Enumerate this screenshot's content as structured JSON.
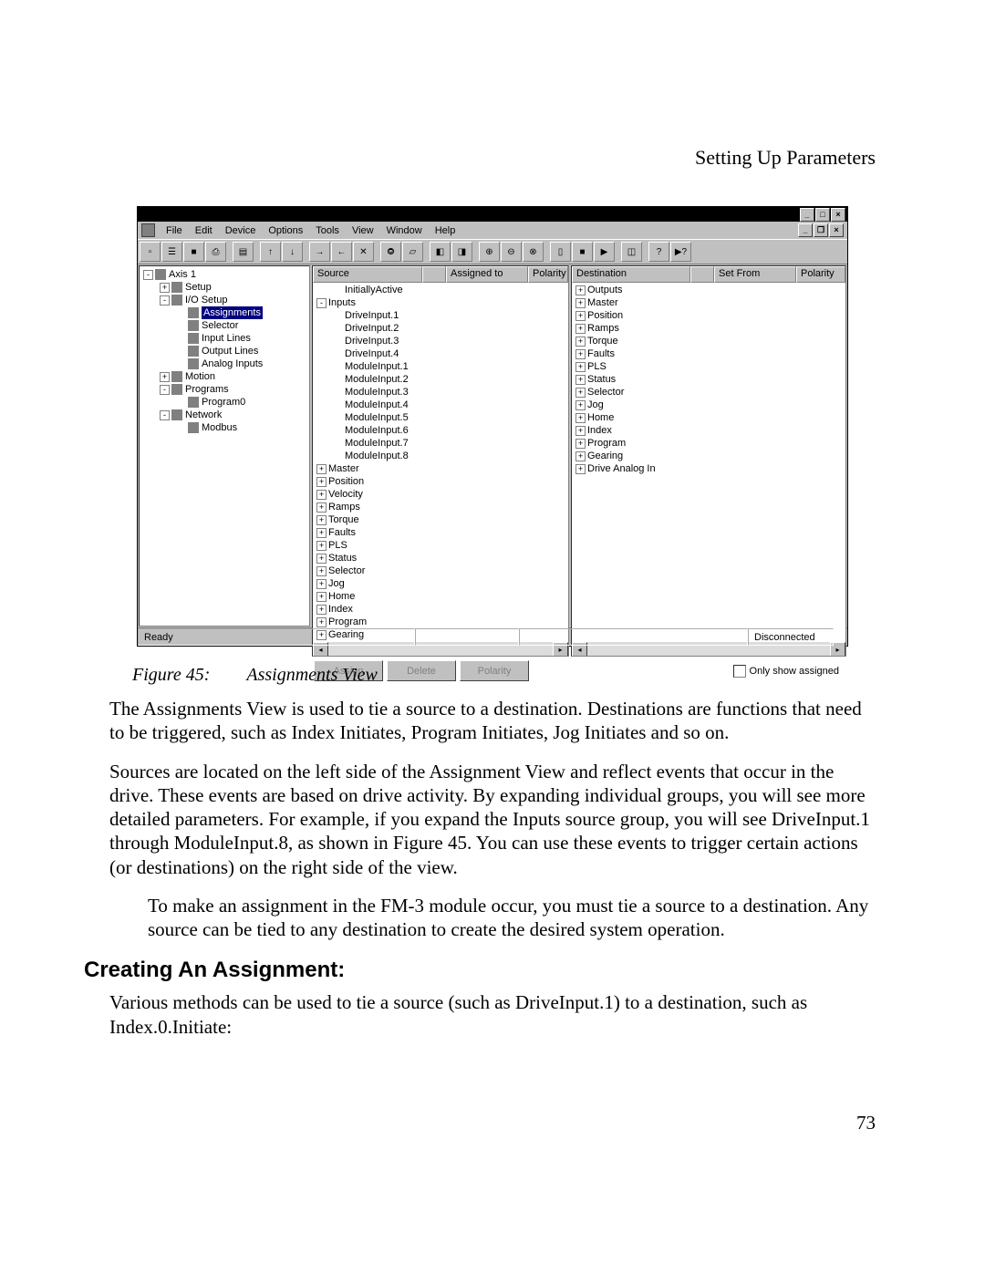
{
  "header": {
    "section_title": "Setting Up Parameters"
  },
  "window": {
    "title_buttons": {
      "min": "_",
      "max": "□",
      "close": "×"
    },
    "mdi_buttons": {
      "min": "_",
      "restore": "❐",
      "close": "×"
    },
    "menu": [
      "File",
      "Edit",
      "Device",
      "Options",
      "Tools",
      "View",
      "Window",
      "Help"
    ]
  },
  "tree": {
    "root": "Axis 1",
    "items": [
      {
        "indent": 0,
        "exp": "-",
        "label": "Axis 1"
      },
      {
        "indent": 1,
        "exp": "+",
        "label": "Setup"
      },
      {
        "indent": 1,
        "exp": "-",
        "label": "I/O Setup"
      },
      {
        "indent": 2,
        "exp": "",
        "label": "Assignments",
        "sel": true
      },
      {
        "indent": 2,
        "exp": "",
        "label": "Selector"
      },
      {
        "indent": 2,
        "exp": "",
        "label": "Input Lines"
      },
      {
        "indent": 2,
        "exp": "",
        "label": "Output Lines"
      },
      {
        "indent": 2,
        "exp": "",
        "label": "Analog Inputs"
      },
      {
        "indent": 1,
        "exp": "+",
        "label": "Motion"
      },
      {
        "indent": 1,
        "exp": "-",
        "label": "Programs"
      },
      {
        "indent": 2,
        "exp": "",
        "label": "Program0"
      },
      {
        "indent": 1,
        "exp": "-",
        "label": "Network"
      },
      {
        "indent": 2,
        "exp": "",
        "label": "Modbus"
      }
    ]
  },
  "source": {
    "headers": [
      "Source",
      "",
      "Assigned to",
      "Polarity"
    ],
    "rows": [
      {
        "i": 1,
        "exp": "",
        "label": "InitiallyActive"
      },
      {
        "i": 0,
        "exp": "-",
        "label": "Inputs"
      },
      {
        "i": 1,
        "exp": "",
        "label": "DriveInput.1"
      },
      {
        "i": 1,
        "exp": "",
        "label": "DriveInput.2"
      },
      {
        "i": 1,
        "exp": "",
        "label": "DriveInput.3"
      },
      {
        "i": 1,
        "exp": "",
        "label": "DriveInput.4"
      },
      {
        "i": 1,
        "exp": "",
        "label": "ModuleInput.1"
      },
      {
        "i": 1,
        "exp": "",
        "label": "ModuleInput.2"
      },
      {
        "i": 1,
        "exp": "",
        "label": "ModuleInput.3"
      },
      {
        "i": 1,
        "exp": "",
        "label": "ModuleInput.4"
      },
      {
        "i": 1,
        "exp": "",
        "label": "ModuleInput.5"
      },
      {
        "i": 1,
        "exp": "",
        "label": "ModuleInput.6"
      },
      {
        "i": 1,
        "exp": "",
        "label": "ModuleInput.7"
      },
      {
        "i": 1,
        "exp": "",
        "label": "ModuleInput.8"
      },
      {
        "i": 0,
        "exp": "+",
        "label": "Master"
      },
      {
        "i": 0,
        "exp": "+",
        "label": "Position"
      },
      {
        "i": 0,
        "exp": "+",
        "label": "Velocity"
      },
      {
        "i": 0,
        "exp": "+",
        "label": "Ramps"
      },
      {
        "i": 0,
        "exp": "+",
        "label": "Torque"
      },
      {
        "i": 0,
        "exp": "+",
        "label": "Faults"
      },
      {
        "i": 0,
        "exp": "+",
        "label": "PLS"
      },
      {
        "i": 0,
        "exp": "+",
        "label": "Status"
      },
      {
        "i": 0,
        "exp": "+",
        "label": "Selector"
      },
      {
        "i": 0,
        "exp": "+",
        "label": "Jog"
      },
      {
        "i": 0,
        "exp": "+",
        "label": "Home"
      },
      {
        "i": 0,
        "exp": "+",
        "label": "Index"
      },
      {
        "i": 0,
        "exp": "+",
        "label": "Program"
      },
      {
        "i": 0,
        "exp": "+",
        "label": "Gearing"
      }
    ]
  },
  "destination": {
    "headers": [
      "Destination",
      "",
      "Set From",
      "Polarity"
    ],
    "rows": [
      {
        "exp": "+",
        "label": "Outputs"
      },
      {
        "exp": "+",
        "label": "Master"
      },
      {
        "exp": "+",
        "label": "Position"
      },
      {
        "exp": "+",
        "label": "Ramps"
      },
      {
        "exp": "+",
        "label": "Torque"
      },
      {
        "exp": "+",
        "label": "Faults"
      },
      {
        "exp": "+",
        "label": "PLS"
      },
      {
        "exp": "+",
        "label": "Status"
      },
      {
        "exp": "+",
        "label": "Selector"
      },
      {
        "exp": "+",
        "label": "Jog"
      },
      {
        "exp": "+",
        "label": "Home"
      },
      {
        "exp": "+",
        "label": "Index"
      },
      {
        "exp": "+",
        "label": "Program"
      },
      {
        "exp": "+",
        "label": "Gearing"
      },
      {
        "exp": "+",
        "label": "Drive Analog In"
      }
    ]
  },
  "buttons": {
    "assign": "Assign",
    "delete": "Delete",
    "polarity": "Polarity"
  },
  "checkbox": {
    "label": "Only show assigned"
  },
  "status": {
    "ready": "Ready",
    "conn": "Disconnected"
  },
  "caption": {
    "prefix": "Figure 45:",
    "title": "Assignments View"
  },
  "para1": "The Assignments View is used to tie a source to a destination. Destinations are functions that need to be triggered, such as Index Initiates, Program Initiates, Jog Initiates and so on.",
  "para2": "Sources are located on the left side of the Assignment View and reflect events that occur in the drive. These events are based on drive activity. By expanding individual groups, you will see more detailed parameters. For example, if you expand the Inputs source group, you will see DriveInput.1 through ModuleInput.8, as shown in Figure 45. You can use these events to trigger certain actions (or destinations) on the right side of the view.",
  "note": "To make an assignment in the FM-3 module occur, you must tie a source to a destination. Any source can be tied to any destination to create the desired system operation.",
  "heading": "Creating An Assignment:",
  "para3": "Various methods can be used to tie a source (such as DriveInput.1) to a destination, such as Index.0.Initiate:",
  "page_num": "73"
}
